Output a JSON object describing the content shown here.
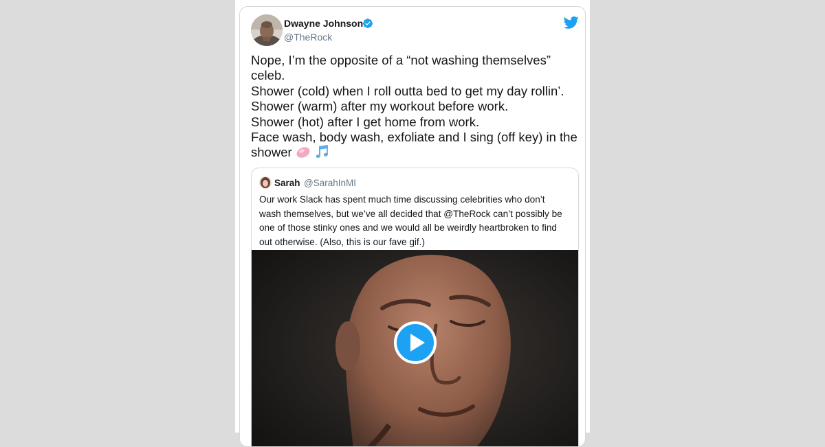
{
  "tweet": {
    "author": {
      "display_name": "Dwayne Johnson",
      "handle": "@TheRock",
      "verified": true,
      "avatar_icon": "profile-photo"
    },
    "brand_icon": "twitter-bird-icon",
    "brand_color": "#1da1f2",
    "text_lines": [
      "Nope, I’m the opposite of a “not washing themselves”",
      "celeb.",
      "Shower (cold) when I roll outta bed to get my day rollin’.",
      "Shower (warm) after my workout before work.",
      "Shower (hot) after I get home from work.",
      "Face wash, body wash, exfoliate and I sing (off key) in the",
      "shower"
    ],
    "emojis": [
      "soap-emoji",
      "musical-notes-emoji"
    ],
    "quoted": {
      "author": {
        "display_name": "Sarah",
        "handle": "@SarahInMI",
        "avatar_icon": "profile-photo"
      },
      "text_lines": [
        "Our work Slack has spent much time discussing celebrities who don’t",
        "wash themselves, but we’ve all decided that @TheRock can’t possibly be",
        "one of those stinky ones and we would all be weirdly heartbroken to find",
        "out otherwise. (Also, this is our fave gif.)"
      ],
      "media": {
        "type": "gif",
        "overlay_icon": "play-button-icon"
      }
    }
  },
  "colors": {
    "text": "#14171a",
    "secondary": "#657786",
    "border": "#d5d8db",
    "background": "#dcdcdc"
  }
}
